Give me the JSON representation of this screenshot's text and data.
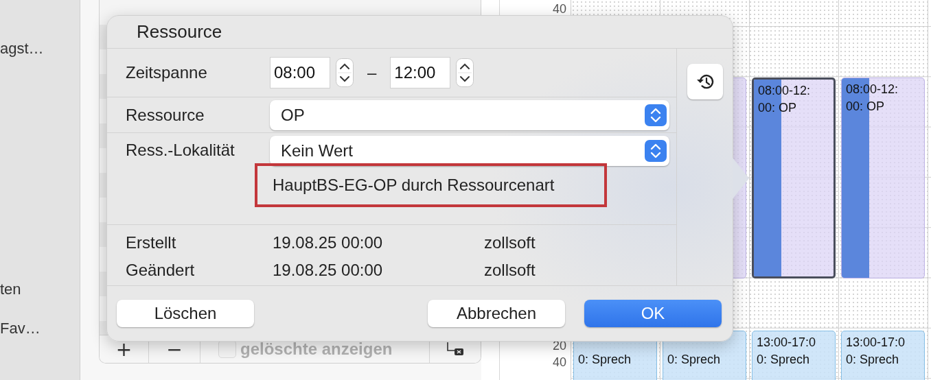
{
  "sidebar": {
    "items": [
      {
        "label": "agst…"
      },
      {
        "label": "ten"
      },
      {
        "label": "Fav…"
      }
    ]
  },
  "list_panel": {
    "toolbar": {
      "add": "+",
      "remove": "−",
      "show_deleted": {
        "label": "gelöschte anzeigen",
        "checked": false,
        "disabled": true
      }
    }
  },
  "calendar": {
    "time_labels": [
      "40",
      "20",
      "40"
    ],
    "columns": [
      {
        "events": [
          {
            "kind": "sprech",
            "selected": false,
            "lines": [
              "0: Sprech"
            ]
          }
        ]
      },
      {
        "events": [
          {
            "kind": "op",
            "selected": false
          },
          {
            "kind": "sprech",
            "selected": false,
            "lines": [
              "0: Sprech"
            ]
          }
        ]
      },
      {
        "events": [
          {
            "kind": "op",
            "selected": true,
            "lines": [
              "08:00-12:",
              "00: OP"
            ]
          },
          {
            "kind": "sprech",
            "selected": false,
            "lines": [
              "13:00-17:0",
              "0: Sprech"
            ]
          }
        ]
      },
      {
        "events": [
          {
            "kind": "op",
            "selected": false,
            "lines": [
              "08:00-12:",
              "00: OP"
            ]
          },
          {
            "kind": "sprech",
            "selected": false,
            "lines": [
              "13:00-17:0",
              "0: Sprech"
            ]
          }
        ]
      }
    ]
  },
  "dialog": {
    "title": "Ressource",
    "fields": [
      {
        "kind": "time_range",
        "label": "Zeitspanne",
        "from": "08:00",
        "separator": "–",
        "to": "12:00"
      },
      {
        "kind": "popup",
        "label": "Ressource",
        "value": "OP"
      },
      {
        "kind": "popup",
        "label": "Ress.-Lokalität",
        "value": "Kein Wert",
        "note": "HauptBS-EG-OP durch Ressourcenart"
      }
    ],
    "meta": [
      {
        "label": "Erstellt",
        "date": "19.08.25 00:00",
        "user": "zollsoft"
      },
      {
        "label": "Geändert",
        "date": "19.08.25 00:00",
        "user": "zollsoft"
      }
    ],
    "buttons": [
      {
        "label": "Löschen",
        "kind": "plain"
      },
      {
        "label": "Abbrechen",
        "kind": "plain"
      },
      {
        "label": "OK",
        "kind": "default"
      }
    ]
  }
}
